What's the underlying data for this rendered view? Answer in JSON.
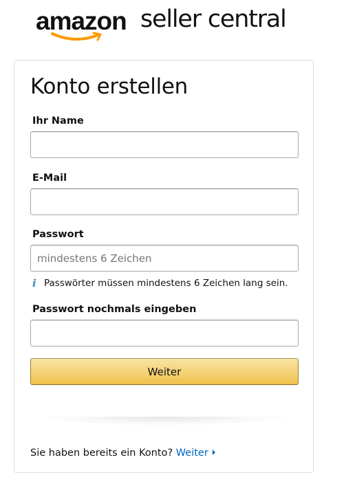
{
  "logo": {
    "brand": "amazon",
    "product": "seller central",
    "smile_color": "#f90"
  },
  "form": {
    "title": "Konto erstellen",
    "name_label": "Ihr Name",
    "name_value": "",
    "email_label": "E-Mail",
    "email_value": "",
    "password_label": "Passwort",
    "password_placeholder": "mindestens 6 Zeichen",
    "password_hint_icon": "info-icon",
    "password_hint": "Passwörter müssen mindestens 6 Zeichen lang sein.",
    "password_confirm_label": "Passwort nochmals eingeben",
    "password_confirm_value": "",
    "submit_label": "Weiter"
  },
  "signin": {
    "prompt": "Sie haben bereits ein Konto?",
    "link_label": "Weiter",
    "link_icon": "caret-right-icon"
  },
  "colors": {
    "button_top": "#f7e4a5",
    "button_bottom": "#f0c14b",
    "link": "#0066c0",
    "info": "#3b8cbf"
  }
}
